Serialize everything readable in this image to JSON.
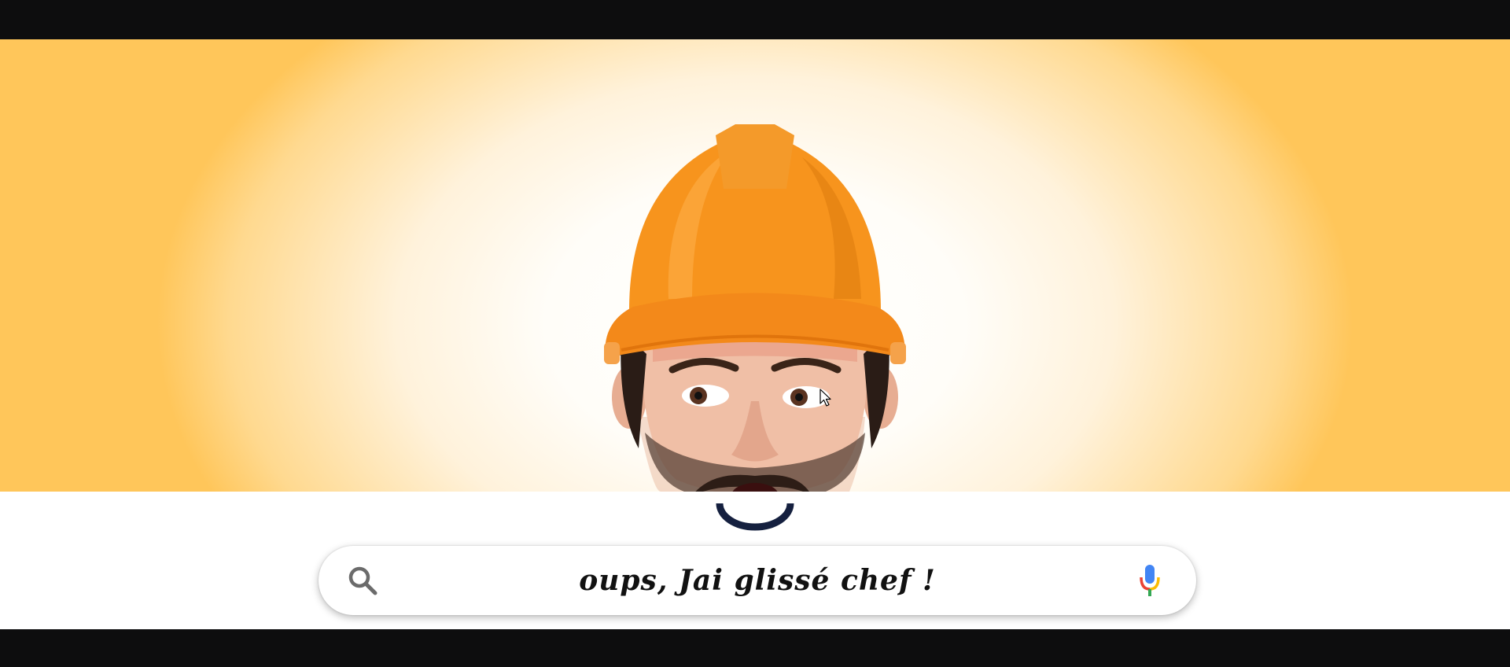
{
  "hero": {
    "image_alt": "worker in orange hard hat looking sideways with open mouth",
    "colors": {
      "helmet": "#f7941d",
      "background_edge": "#ffc65a"
    }
  },
  "loader": {
    "icon": "loading-spinner",
    "color": "#15203f"
  },
  "search": {
    "query": "oups, Jai glissé chef !",
    "search_icon": "search-icon",
    "mic_icon": "microphone-icon"
  }
}
